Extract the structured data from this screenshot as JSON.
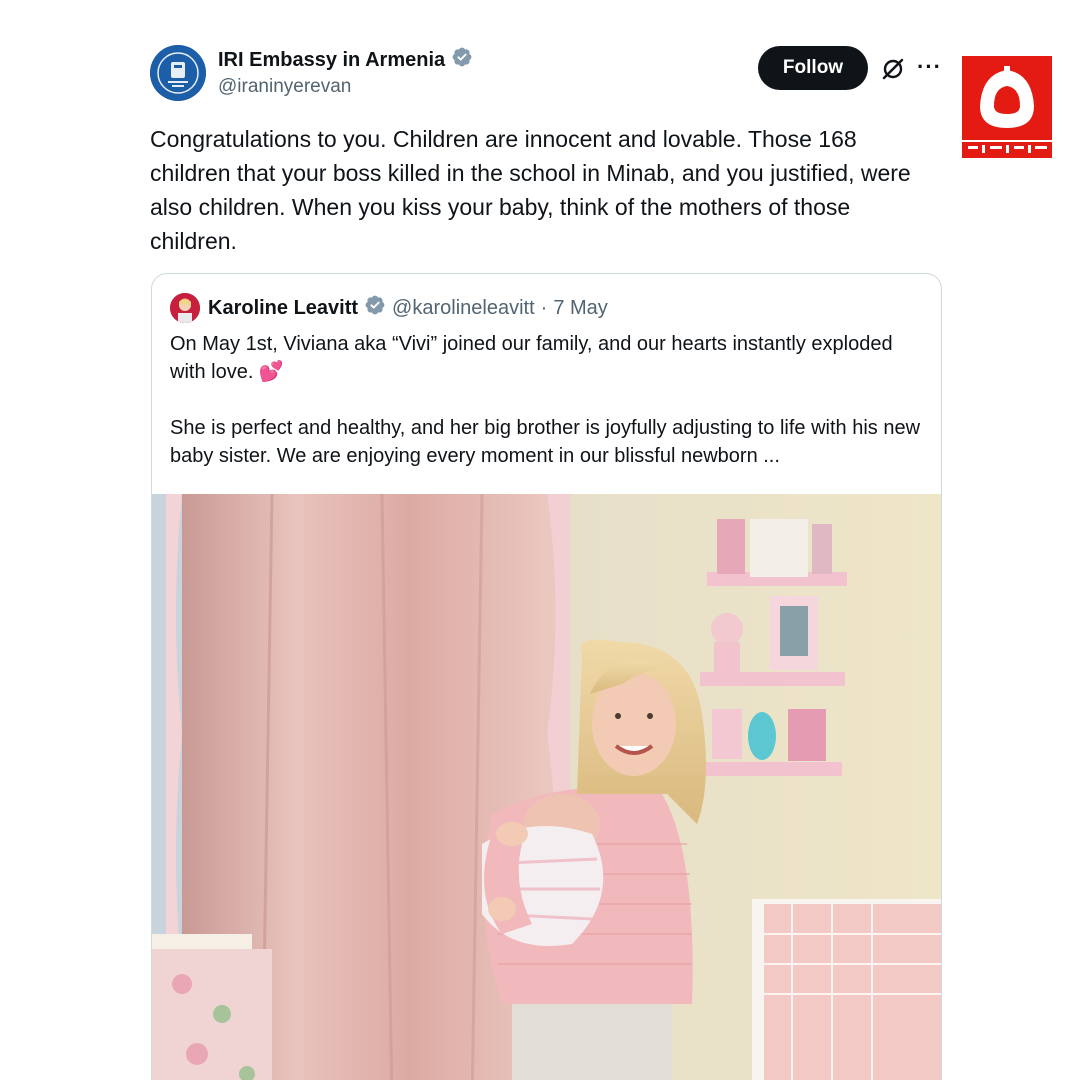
{
  "post": {
    "author_name": "IRI Embassy in Armenia",
    "author_handle": "@iraninyerevan",
    "follow_label": "Follow",
    "more_label": "···",
    "text": "Congratulations to you. Children are innocent and lovable. Those 168 children that your boss killed in the school in Minab, and you justified, were also children. When you kiss your baby, think of the mothers of those children."
  },
  "quote": {
    "author_name": "Karoline Leavitt",
    "author_handle": "@karolineleavitt",
    "separator": "·",
    "date": "7 May",
    "paragraph1": "On May 1st, Viviana aka “Vivi” joined our family, and our hearts instantly exploded with love. 💕",
    "paragraph2": "She is perfect and healthy, and her big brother is joyfully adjusting to life with his new baby sister. We are enjoying every moment in our blissful newborn ..."
  },
  "colors": {
    "verified": "#829aab",
    "follow_bg": "#0f1419",
    "logo_red": "#e41b13",
    "text_secondary": "#536471"
  },
  "icons": [
    "verified-badge-icon",
    "grok-icon",
    "more-icon",
    "watermark-logo"
  ]
}
